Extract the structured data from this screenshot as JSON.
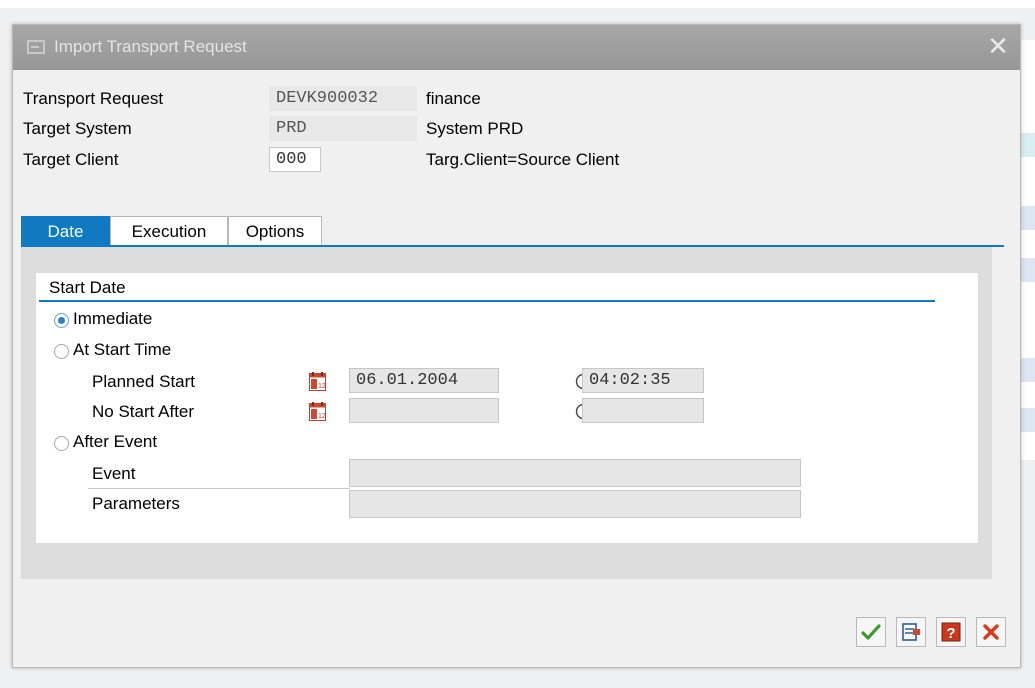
{
  "dialog": {
    "title": "Import Transport Request",
    "close_label": "✕"
  },
  "header_fields": {
    "transport_request": {
      "label": "Transport Request",
      "value": "DEVK900032",
      "description": "finance"
    },
    "target_system": {
      "label": "Target System",
      "value": "PRD",
      "description": "System PRD"
    },
    "target_client": {
      "label": "Target Client",
      "value": "000",
      "description": "Targ.Client=Source Client"
    }
  },
  "tabs": [
    {
      "label": "Date",
      "active": true
    },
    {
      "label": "Execution",
      "active": false
    },
    {
      "label": "Options",
      "active": false
    }
  ],
  "start_date": {
    "group_title": "Start Date",
    "options": [
      {
        "label": "Immediate",
        "selected": true
      },
      {
        "label": "At Start Time",
        "selected": false
      },
      {
        "label": "After Event",
        "selected": false
      }
    ],
    "planned_start": {
      "label": "Planned Start",
      "date": "06.01.2004",
      "time": "04:02:35"
    },
    "no_start_after": {
      "label": "No Start After",
      "date": "",
      "time": ""
    },
    "event": {
      "label": "Event",
      "value": ""
    },
    "parameters": {
      "label": "Parameters",
      "value": ""
    }
  },
  "footer_buttons": [
    {
      "name": "confirm-button",
      "icon": "checkmark-icon"
    },
    {
      "name": "execute-button",
      "icon": "transport-icon"
    },
    {
      "name": "help-button",
      "icon": "help-icon"
    },
    {
      "name": "cancel-button",
      "icon": "cancel-x-icon"
    }
  ],
  "colors": {
    "accent": "#0f79c2",
    "titlebar": "#9f9f9f",
    "confirm": "#3a9a2a",
    "cancel": "#d9381e",
    "help": "#c9381e"
  }
}
